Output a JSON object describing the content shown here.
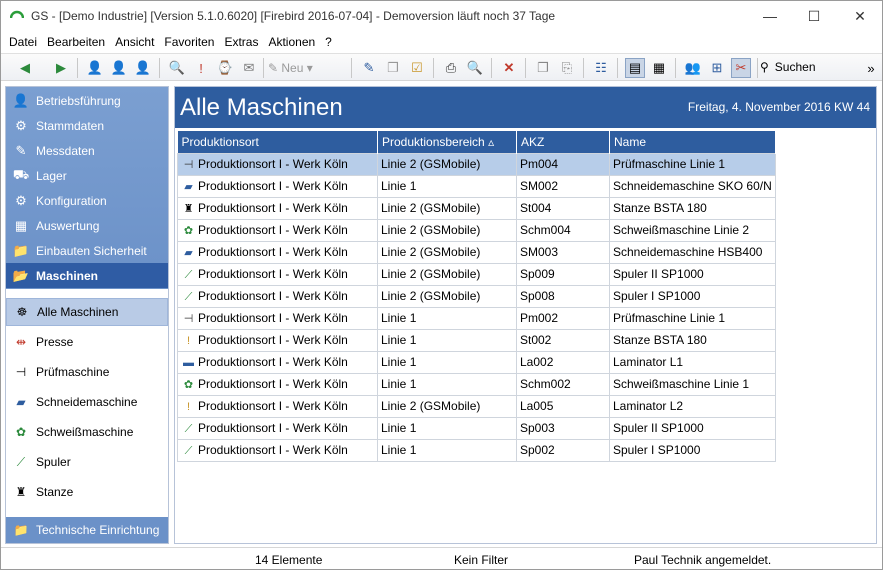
{
  "window": {
    "title": "GS - [Demo Industrie]  [Version  5.1.0.6020]  [Firebird 2016-07-04] - Demoversion läuft noch 37 Tage",
    "controls": {
      "minimize": "—",
      "maximize": "☐",
      "close": "✕"
    }
  },
  "menu": [
    "Datei",
    "Bearbeiten",
    "Ansicht",
    "Favoriten",
    "Extras",
    "Aktionen",
    "?"
  ],
  "toolbar": {
    "new_label": "Neu",
    "search_label": "Suchen"
  },
  "sidebar": {
    "groups": [
      {
        "label": "Betriebsführung",
        "icon": "person-icon"
      },
      {
        "label": "Stammdaten",
        "icon": "stammdaten-icon"
      },
      {
        "label": "Messdaten",
        "icon": "probe-icon"
      },
      {
        "label": "Lager",
        "icon": "warehouse-icon"
      },
      {
        "label": "Konfiguration",
        "icon": "gears-icon"
      },
      {
        "label": "Auswertung",
        "icon": "chart-icon"
      },
      {
        "label": "Einbauten Sicherheit",
        "icon": "folder-icon"
      },
      {
        "label": "Maschinen",
        "icon": "folder-open-icon",
        "active": true
      }
    ],
    "sub_items": [
      {
        "label": "Alle Maschinen",
        "icon": "all-machines-icon",
        "active": true
      },
      {
        "label": "Presse",
        "icon": "press-icon"
      },
      {
        "label": "Prüfmaschine",
        "icon": "test-machine-icon"
      },
      {
        "label": "Schneidemaschine",
        "icon": "cutting-machine-icon"
      },
      {
        "label": "Schweißmaschine",
        "icon": "welding-machine-icon"
      },
      {
        "label": "Spuler",
        "icon": "winder-icon"
      },
      {
        "label": "Stanze",
        "icon": "punch-icon"
      }
    ],
    "bottom": {
      "label": "Technische Einrichtung",
      "icon": "folder-icon"
    }
  },
  "main": {
    "title": "Alle Maschinen",
    "date": "Freitag, 4. November 2016  KW 44",
    "columns": [
      "Produktionsort",
      "Produktionsbereich",
      "AKZ",
      "Name"
    ],
    "rows": [
      {
        "icon": "test-machine-icon",
        "ort": "Produktionsort I - Werk Köln",
        "bereich": "Linie 2 (GSMobile)",
        "akz": "Pm004",
        "name": "Prüfmaschine Linie 1",
        "selected": true
      },
      {
        "icon": "cutting-machine-icon",
        "ort": "Produktionsort I - Werk Köln",
        "bereich": "Linie 1",
        "akz": "SM002",
        "name": "Schneidemaschine SKO 60/N"
      },
      {
        "icon": "punch-icon",
        "ort": "Produktionsort I - Werk Köln",
        "bereich": "Linie 2 (GSMobile)",
        "akz": "St004",
        "name": "Stanze BSTA 180"
      },
      {
        "icon": "welding-machine-icon",
        "ort": "Produktionsort I - Werk Köln",
        "bereich": "Linie 2 (GSMobile)",
        "akz": "Schm004",
        "name": "Schweißmaschine Linie 2"
      },
      {
        "icon": "cutting-machine-icon",
        "ort": "Produktionsort I - Werk Köln",
        "bereich": "Linie 2 (GSMobile)",
        "akz": "SM003",
        "name": "Schneidemaschine HSB400"
      },
      {
        "icon": "winder-icon",
        "ort": "Produktionsort I - Werk Köln",
        "bereich": "Linie 2 (GSMobile)",
        "akz": "Sp009",
        "name": "Spuler II SP1000"
      },
      {
        "icon": "winder-icon",
        "ort": "Produktionsort I - Werk Köln",
        "bereich": "Linie 2 (GSMobile)",
        "akz": "Sp008",
        "name": "Spuler I SP1000"
      },
      {
        "icon": "test-machine-icon",
        "ort": "Produktionsort I - Werk Köln",
        "bereich": "Linie 1",
        "akz": "Pm002",
        "name": "Prüfmaschine Linie 1"
      },
      {
        "icon": "warning-icon",
        "ort": "Produktionsort I - Werk Köln",
        "bereich": "Linie 1",
        "akz": "St002",
        "name": "Stanze BSTA 180"
      },
      {
        "icon": "laminator-icon",
        "ort": "Produktionsort I - Werk Köln",
        "bereich": "Linie 1",
        "akz": "La002",
        "name": "Laminator L1"
      },
      {
        "icon": "welding-machine-icon",
        "ort": "Produktionsort I - Werk Köln",
        "bereich": "Linie 1",
        "akz": "Schm002",
        "name": "Schweißmaschine Linie 1"
      },
      {
        "icon": "warning-icon",
        "ort": "Produktionsort I - Werk Köln",
        "bereich": "Linie 2 (GSMobile)",
        "akz": "La005",
        "name": "Laminator L2"
      },
      {
        "icon": "winder-icon",
        "ort": "Produktionsort I - Werk Köln",
        "bereich": "Linie 1",
        "akz": "Sp003",
        "name": "Spuler II SP1000"
      },
      {
        "icon": "winder-icon",
        "ort": "Produktionsort I - Werk Köln",
        "bereich": "Linie 1",
        "akz": "Sp002",
        "name": "Spuler I SP1000"
      }
    ]
  },
  "status": {
    "count": "14 Elemente",
    "filter": "Kein Filter",
    "user": "Paul Technik angemeldet."
  },
  "colors": {
    "header_blue": "#2e5d9f",
    "nav_blue": "#6b91c8",
    "selection": "#b7cde9"
  }
}
